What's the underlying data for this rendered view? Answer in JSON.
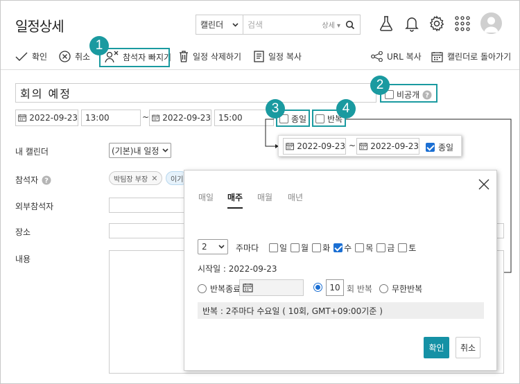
{
  "header": {
    "title": "일정상세",
    "search": {
      "scope": "캘린더",
      "placeholder": "검색",
      "detail": "상세"
    }
  },
  "toolbar": {
    "confirm": "확인",
    "cancel": "취소",
    "remove_attendee": "참석자 빠지기",
    "delete": "일정 삭제하기",
    "copy": "일정 복사",
    "url_copy": "URL 복사",
    "back_to_calendar": "캘린더로 돌아가기"
  },
  "badges": [
    "1",
    "2",
    "3",
    "4"
  ],
  "event": {
    "title": "회의 예정",
    "private_label": "비공개",
    "start_date": "2022-09-23",
    "start_time": "13:00",
    "range_sep": "~",
    "end_date": "2022-09-23",
    "end_time": "15:00",
    "allday_label": "종일",
    "repeat_label": "반복",
    "allday_checked": false,
    "repeat_checked": false
  },
  "allday_preview": {
    "start_date": "2022-09-23",
    "sep": "~",
    "end_date": "2022-09-23",
    "allday_label": "종일",
    "allday_checked": true
  },
  "form": {
    "calendar_label": "내 캘린더",
    "calendar_value": "(기본)내 일정",
    "attendees_label": "참석자",
    "attendees": [
      "박팀장 부장",
      "이기"
    ],
    "external_label": "외부참석자",
    "location_label": "장소",
    "content_label": "내용"
  },
  "repeat_popup": {
    "tabs": [
      "매일",
      "매주",
      "매월",
      "매년"
    ],
    "active_tab": "매주",
    "interval": "2",
    "interval_unit": "주마다",
    "days": [
      {
        "label": "일",
        "checked": false
      },
      {
        "label": "월",
        "checked": false
      },
      {
        "label": "화",
        "checked": false
      },
      {
        "label": "수",
        "checked": true
      },
      {
        "label": "목",
        "checked": false
      },
      {
        "label": "금",
        "checked": false
      },
      {
        "label": "토",
        "checked": false
      }
    ],
    "start_text": "시작일 : 2022-09-23",
    "end_option_date": "반복종료",
    "count_value": "10",
    "count_unit": "회 반복",
    "infinite_label": "무한반복",
    "selected_end_option": "count",
    "summary": "반복 : 2주마다 수요일 ( 10회, GMT+09:00기준 )",
    "ok": "확인",
    "cancel": "취소"
  },
  "colors": {
    "accent": "#1a9aa0",
    "primary_button": "#1591a5",
    "checkbox_on": "#1b6fd3"
  }
}
